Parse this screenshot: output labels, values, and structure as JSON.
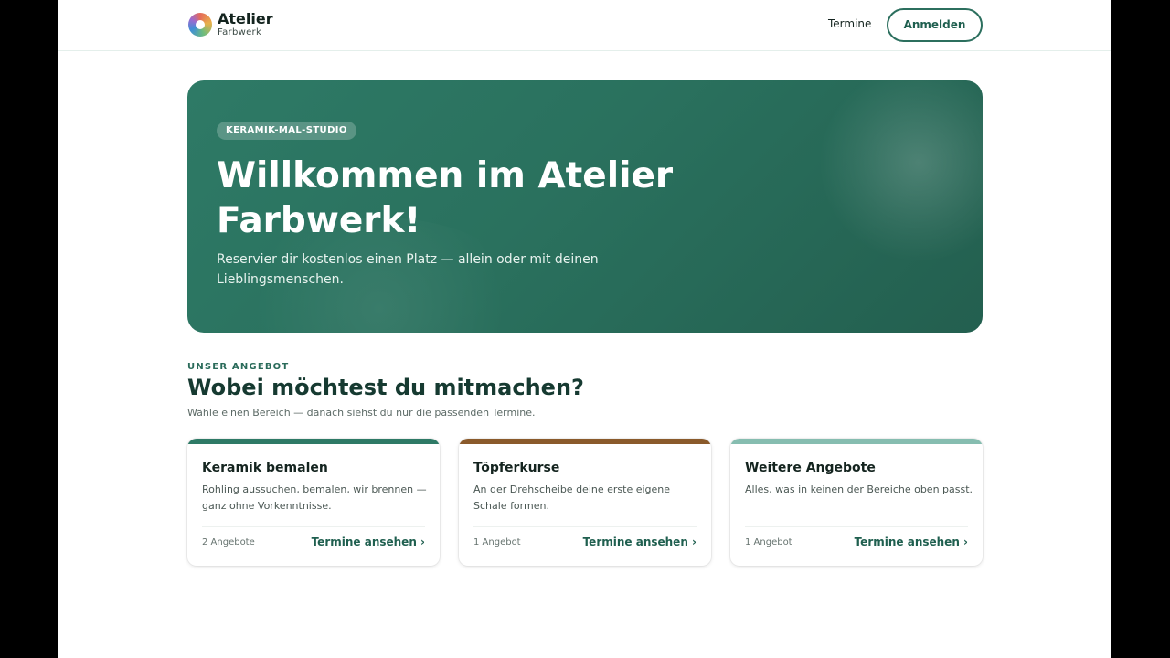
{
  "brand": {
    "name": "Atelier",
    "sub": "Farbwerk",
    "logo_icon": "color-wheel-icon"
  },
  "nav": {
    "termine_label": "Termine",
    "login_label": "Anmelden"
  },
  "hero": {
    "badge": "KERAMIK-MAL-STUDIO",
    "title": "Willkommen im Atelier Farbwerk!",
    "subtitle": "Reservier dir kostenlos einen Platz — allein oder mit deinen Lieblingsmenschen."
  },
  "section": {
    "eyebrow": "UNSER ANGEBOT",
    "title": "Wobei möchtest du mitmachen?",
    "subtitle": "Wähle einen Bereich — danach siehst du nur die passenden Termine."
  },
  "cards": [
    {
      "title": "Keramik bemalen",
      "description": "Rohling aussuchen, bemalen, wir brennen — ganz ohne Vorkenntnisse.",
      "count": "2 Angebote",
      "link": "Termine ansehen ›",
      "accent": "#2e7a66"
    },
    {
      "title": "Töpferkurse",
      "description": "An der Drehscheibe deine erste eigene Schale formen.",
      "count": "1 Angebot",
      "link": "Termine ansehen ›",
      "accent": "#8a5a2b"
    },
    {
      "title": "Weitere Angebote",
      "description": "Alles, was in keinen der Bereiche oben passt.",
      "count": "1 Angebot",
      "link": "Termine ansehen ›",
      "accent": "#86bdb0"
    }
  ],
  "colors": {
    "primary": "#2c6f5e",
    "heading": "#163a31"
  }
}
